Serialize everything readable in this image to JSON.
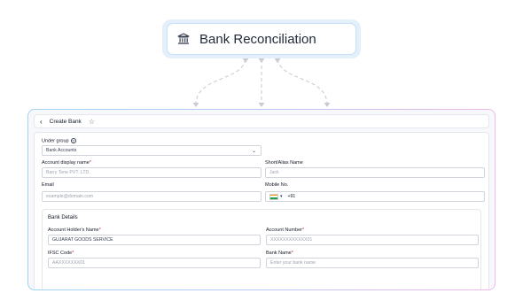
{
  "pill": {
    "title": "Bank Reconciliation",
    "icon": "bank-icon"
  },
  "header": {
    "title": "Create Bank",
    "back_icon": "chevron-left-icon",
    "star_icon": "star-icon"
  },
  "form": {
    "under_group": {
      "label": "Under group",
      "value": "Bank Accounts"
    },
    "account_display_name": {
      "label": "Account display name",
      "placeholder": "Barry Tone PVT. LTD."
    },
    "short_alias_name": {
      "label": "Short/Alias Name",
      "placeholder": "Jack"
    },
    "email": {
      "label": "Email",
      "placeholder": "example@domain.com"
    },
    "mobile": {
      "label": "Mobile No.",
      "code": "+91"
    },
    "bank_details": {
      "title": "Bank Details",
      "account_holder_name": {
        "label": "Account Holder's Name",
        "value": "GUJARAT GOODS SERVICE"
      },
      "account_number": {
        "label": "Account Number",
        "placeholder": "XXXXXXXXXXXX01"
      },
      "ifsc_code": {
        "label": "IFSC Code",
        "placeholder": "AAXXXXXXX01"
      },
      "bank_name": {
        "label": "Bank Name",
        "placeholder": "Enter your bank name"
      }
    }
  },
  "colors": {
    "accent": "#9fd4f2",
    "required": "#dc2626"
  }
}
